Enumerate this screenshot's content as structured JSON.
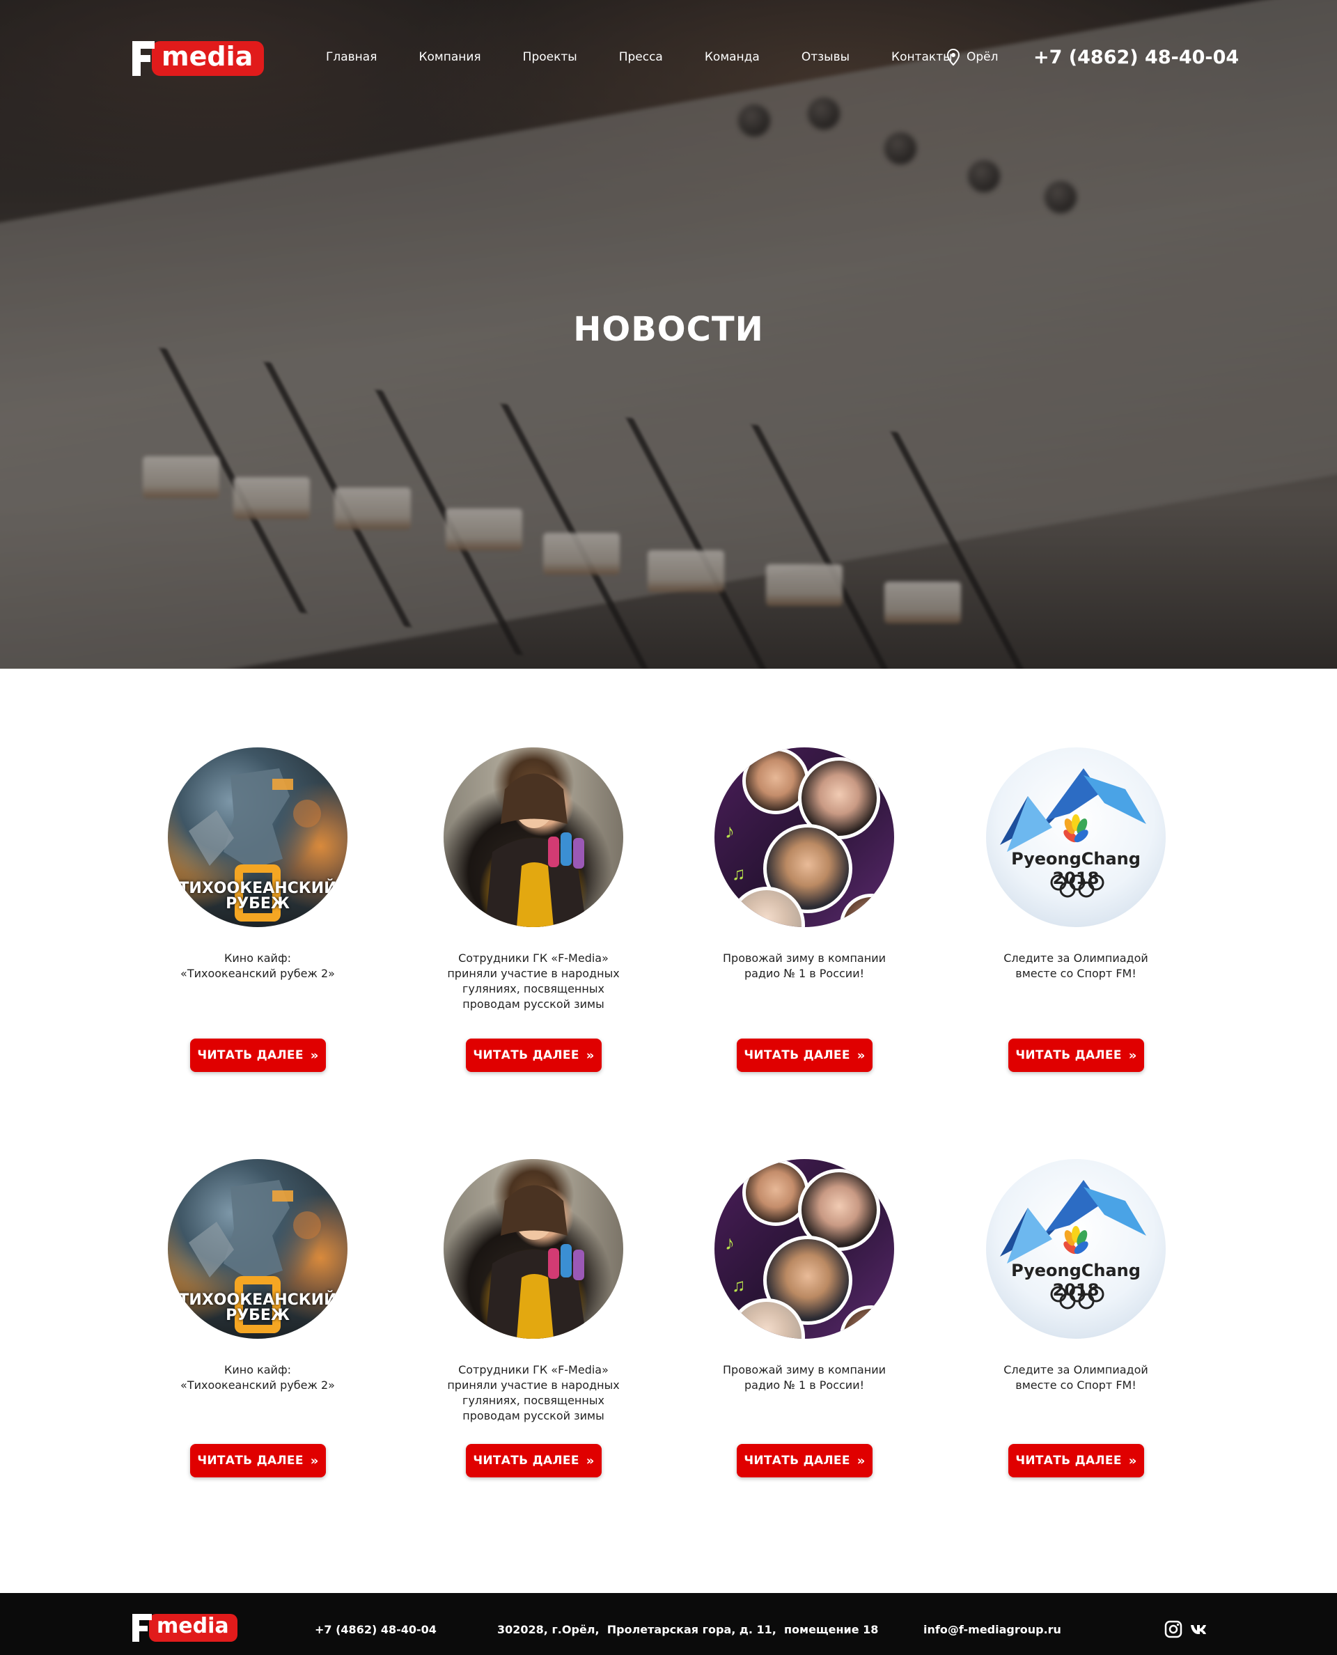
{
  "header": {
    "logo_text": "media",
    "nav": [
      "Главная",
      "Компания",
      "Проекты",
      "Пресса",
      "Команда",
      "Отзывы",
      "Контакты"
    ],
    "city": "Орёл",
    "phone": "+7 (4862) 48-40-04"
  },
  "hero": {
    "title": "НОВОСТИ"
  },
  "news": {
    "button_label": "ЧИТАТЬ ДАЛЕЕ",
    "items": [
      {
        "text": "Кино кайф:\n«Тихоокеанский рубеж 2»",
        "image": "pacific-rim-poster",
        "poster_title": "ТИХООКЕАНСКИЙ\nРУБЕЖ"
      },
      {
        "text": "Сотрудники ГК «F-Media»\nприняли участие в народных\nгуляниях, посвященных\nпроводам русской зимы",
        "image": "woman-in-shawl"
      },
      {
        "text": "Провожай зиму в компании\nрадио № 1 в России!",
        "image": "celebrity-collage"
      },
      {
        "text": "Следите за Олимпиадой\nвместе со Спорт FM!",
        "image": "pyeongchang-2018-logo",
        "logo_text": "PyeongChang 2018"
      },
      {
        "text": "Кино кайф:\n«Тихоокеанский рубеж 2»",
        "image": "pacific-rim-poster",
        "poster_title": "ТИХООКЕАНСКИЙ\nРУБЕЖ"
      },
      {
        "text": "Сотрудники ГК «F-Media»\nприняли участие в народных\nгуляниях, посвященных\nпроводам русской зимы",
        "image": "woman-in-shawl"
      },
      {
        "text": "Провожай зиму в компании\nрадио № 1 в России!",
        "image": "celebrity-collage"
      },
      {
        "text": "Следите за Олимпиадой\nвместе со Спорт FM!",
        "image": "pyeongchang-2018-logo",
        "logo_text": "PyeongChang 2018"
      }
    ]
  },
  "footer": {
    "logo_text": "media",
    "phone": "+7 (4862) 48-40-04",
    "address": "302028, г.Орёл,  Пролетарская гора, д. 11,  помещение 18",
    "email": "info@f-mediagroup.ru",
    "social": [
      "instagram-icon",
      "vk-icon"
    ]
  },
  "colors": {
    "accent": "#e00000",
    "logo_red": "#e11b1b",
    "footer_bg": "#0b0b0b"
  }
}
